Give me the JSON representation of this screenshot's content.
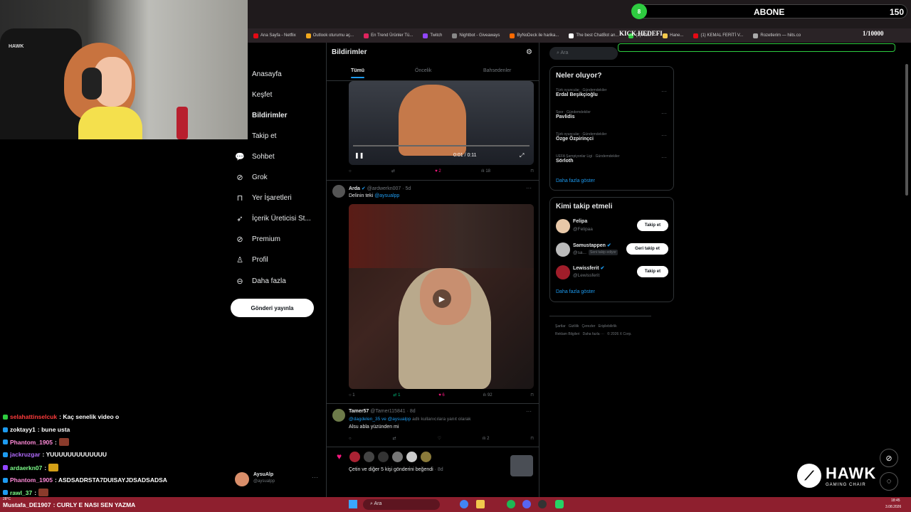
{
  "stream": {
    "abone_label": "ABONE",
    "abone_count": "150",
    "abone_badge": "8",
    "kick_label": "KICK HEDEFI",
    "kick_count": "1/10000",
    "brand": "HAWK",
    "brand_sub": "GAMING CHAIR"
  },
  "bookmarks": [
    "Ana Sayfa - Netflix",
    "Outlook oturumu aç...",
    "En Trend Ürünler Tü...",
    "Twitch",
    "Nightbot - Giveaways",
    "ByNoDeck ile harika...",
    "The best ChatBot an...",
    "(2) Ask...",
    "Hane...",
    "(1) KEMAL FERİTİ V...",
    "Rozetlerim — hiits.co"
  ],
  "sidebar": {
    "items": [
      {
        "label": "Anasayfa",
        "icon": "home-icon"
      },
      {
        "label": "Keşfet",
        "icon": "explore-icon"
      },
      {
        "label": "Bildirimler",
        "icon": "bell-icon"
      },
      {
        "label": "Takip et",
        "icon": "follow-icon"
      },
      {
        "label": "Sohbet",
        "icon": "chat-icon"
      },
      {
        "label": "Grok",
        "icon": "grok-icon"
      },
      {
        "label": "Yer İşaretleri",
        "icon": "bookmark-icon"
      },
      {
        "label": "İçerik Üreticisi St...",
        "icon": "rocket-icon"
      },
      {
        "label": "Premium",
        "icon": "premium-icon"
      },
      {
        "label": "Profil",
        "icon": "profile-icon"
      },
      {
        "label": "Daha fazla",
        "icon": "more-icon"
      }
    ],
    "post_button": "Gönderi yayınla",
    "account_name": "AysuAlp",
    "account_handle": "@aysualpp"
  },
  "main": {
    "title": "Bildirimler",
    "tabs": [
      "Tümü",
      "Öncelik",
      "Bahsedenler"
    ],
    "video1": {
      "time": "0:01 / 0:11",
      "replies": "",
      "likes": "2",
      "views": "18"
    },
    "post1": {
      "name": "Arda",
      "handle": "@ardwerkn007",
      "age": "· 5d",
      "text_prefix": "Delinin teki ",
      "text_mention": "@aysualpp",
      "replies": "1",
      "reposts": "1",
      "likes": "6",
      "views": "92"
    },
    "post2": {
      "name": "Tamer57",
      "handle": "@Tamer115841",
      "age": "· 8d",
      "reply_mentions": "@dagdelen_35 ve @aysualpp",
      "reply_suffix": " adlı kullanıcılara yanıt olarak",
      "text": "Alsu abla yüzünden mi",
      "views": "2"
    },
    "like_group": {
      "text": "Çetin ve diğer 5 kişi gönderini beğendi",
      "age": "· 8d"
    }
  },
  "right": {
    "search_placeholder": "Ara",
    "trends_title": "Neler oluyor?",
    "trends": [
      {
        "category": "Türk oyuncular · Gündemdekiler",
        "name": "Erdal Beşikçioğlu"
      },
      {
        "category": "Spor · Gündemdekiler",
        "name": "Pavlidis"
      },
      {
        "category": "Türk oyuncular · Gündemdekiler",
        "name": "Özge Özpirinçci"
      },
      {
        "category": "UEFA Şampiyonlar Ligi · Gündemdekiler",
        "name": "Sörloth"
      }
    ],
    "show_more": "Daha fazla göster",
    "who_title": "Kimi takip etmeli",
    "suggestions": [
      {
        "name": "Felipa",
        "handle": "@Felipaa",
        "button": "Takip et",
        "note": ""
      },
      {
        "name": "Samustappen",
        "handle": "@sa...",
        "button": "Geri takip et",
        "note": "Seni takip ediyor"
      },
      {
        "name": "Lewissferit",
        "handle": "@Lewissferit",
        "button": "Takip et",
        "note": ""
      }
    ],
    "show_more2": "Daha fazla göster",
    "footer1": "Şartlar   Gizlilik   Çerezler   Erişilebilirlik",
    "footer2": "Reklam Bilgileri   Daha fazla ···   © 2026 X Corp."
  },
  "chat": [
    {
      "user": "selahattinselcuk",
      "msg": ": Kaç senelik video o",
      "color": "#ff3b3b"
    },
    {
      "user": "zoktayy1",
      "msg": ": bune usta",
      "color": "#ffffff"
    },
    {
      "user": "Phantom_1905",
      "msg": ":",
      "color": "#ff8ad8"
    },
    {
      "user": "jackruzgar",
      "msg": ": YUUUUUUUUUUUUU",
      "color": "#b36bff"
    },
    {
      "user": "ardaerkn07",
      "msg": ":",
      "color": "#7dff8a"
    },
    {
      "user": "Phantom_1905",
      "msg": ": ASDSADRSTA7DUISAYJDSADSADSA",
      "color": "#ff8ad8"
    },
    {
      "user": "rawl_37",
      "msg": ":",
      "color": "#7dff8a"
    },
    {
      "user": "Mustafa_DE1907",
      "msg": ": CURLY E NASI SEN YAZMA",
      "color": "#ffffff"
    }
  ],
  "taskbar": {
    "search": "Ara",
    "weather": "28°C",
    "time": "18:45",
    "date": "3.08.2026"
  }
}
